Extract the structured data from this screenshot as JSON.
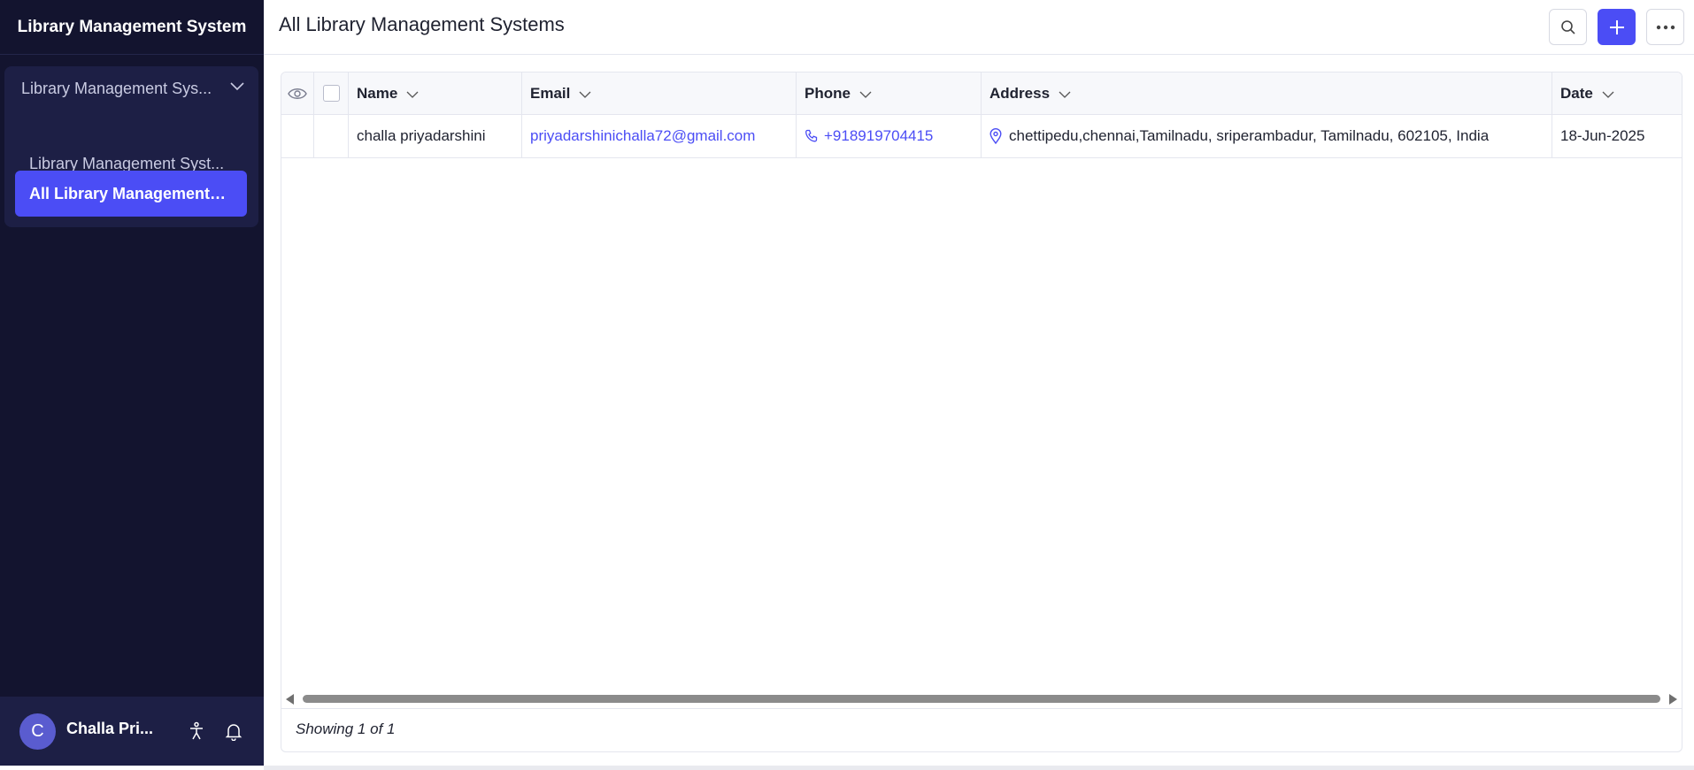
{
  "sidebar": {
    "title": "Library Management System",
    "group": {
      "label": "Library Management Sys..."
    },
    "items": [
      {
        "label": "Library Management Syst..."
      },
      {
        "label": "All Library Management S..."
      }
    ],
    "user": {
      "initial": "C",
      "name": "Challa Pri..."
    }
  },
  "header": {
    "title": "All Library Management Systems"
  },
  "table": {
    "columns": [
      "Name",
      "Email",
      "Phone",
      "Address",
      "Date"
    ],
    "rows": [
      {
        "name": "challa priyadarshini",
        "email": "priyadarshinichalla72@gmail.com",
        "phone": "+918919704415",
        "address": "chettipedu,chennai,Tamilnadu, sriperambadur, Tamilnadu, 602105, India",
        "date": "18-Jun-2025"
      }
    ],
    "footer": "Showing 1 of 1"
  },
  "icons": {
    "view": "eye-icon",
    "search": "search-icon",
    "add": "plus-icon",
    "more": "more-icon",
    "phone": "phone-icon",
    "location": "location-pin-icon",
    "accessibility": "accessibility-icon",
    "notifications": "bell-icon"
  },
  "colors": {
    "sidebar_bg": "#13142f",
    "sidebar_panel": "#1d1f45",
    "accent": "#4b4df5",
    "link": "#4b4df5"
  }
}
